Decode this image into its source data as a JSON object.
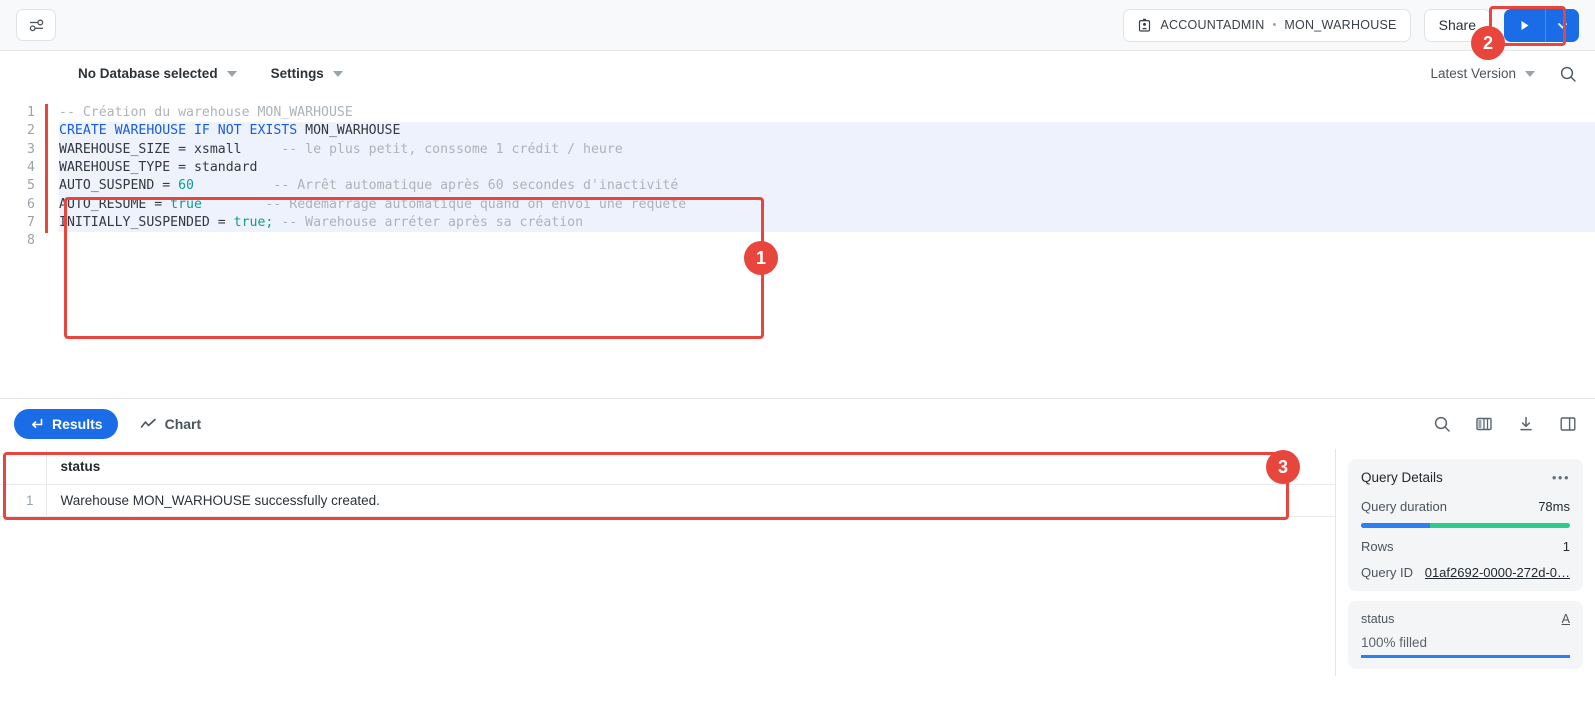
{
  "topbar": {
    "settings_icon": "sliders-icon",
    "role_icon": "badge-id-icon",
    "role": "ACCOUNTADMIN",
    "separator_dot": "•",
    "warehouse": "MON_WARHOUSE",
    "share_label": "Share",
    "run_icon": "play-icon",
    "run_caret_icon": "chevron-down-icon",
    "run_color": "#1a6ce7"
  },
  "editor_toolbar": {
    "database_label": "No Database selected",
    "settings_label": "Settings",
    "version_label": "Latest Version",
    "search_icon": "search-icon"
  },
  "editor": {
    "line_numbers": [
      "1",
      "2",
      "3",
      "4",
      "5",
      "6",
      "7",
      "8"
    ],
    "lines": [
      {
        "n": 1,
        "segments": [
          {
            "t": "-- Création du warehouse MON_WARHOUSE",
            "c": "cm"
          }
        ]
      },
      {
        "n": 2,
        "segments": [
          {
            "t": "CREATE WAREHOUSE IF NOT EXISTS ",
            "c": "k"
          },
          {
            "t": "MON_WARHOUSE",
            "c": "pl"
          }
        ]
      },
      {
        "n": 3,
        "segments": [
          {
            "t": "WAREHOUSE_SIZE = xsmall     ",
            "c": "pl"
          },
          {
            "t": "-- le plus petit, conssome 1 crédit / heure",
            "c": "cm"
          }
        ]
      },
      {
        "n": 4,
        "segments": [
          {
            "t": "WAREHOUSE_TYPE = standard",
            "c": "pl"
          }
        ]
      },
      {
        "n": 5,
        "segments": [
          {
            "t": "AUTO_SUSPEND = ",
            "c": "pl"
          },
          {
            "t": "60",
            "c": "num"
          },
          {
            "t": "          ",
            "c": "pl"
          },
          {
            "t": "-- Arrêt automatique après 60 secondes d'inactivité",
            "c": "cm"
          }
        ]
      },
      {
        "n": 6,
        "segments": [
          {
            "t": "AUTO_RESUME = ",
            "c": "pl"
          },
          {
            "t": "true",
            "c": "bool"
          },
          {
            "t": "        ",
            "c": "pl"
          },
          {
            "t": "-- Redémarrage automatique quand on envoi une requête",
            "c": "cm"
          }
        ]
      },
      {
        "n": 7,
        "segments": [
          {
            "t": "INITIALLY_SUSPENDED = ",
            "c": "pl"
          },
          {
            "t": "true;",
            "c": "bool"
          },
          {
            "t": " ",
            "c": "pl"
          },
          {
            "t": "-- Warehouse arréter après sa création",
            "c": "cm"
          }
        ]
      },
      {
        "n": 8,
        "segments": [
          {
            "t": "",
            "c": "pl"
          }
        ]
      }
    ]
  },
  "results": {
    "tab_results_label": "Results",
    "tab_results_icon": "return-arrow-icon",
    "tab_chart_label": "Chart",
    "tab_chart_icon": "line-chart-icon",
    "toolbar_icons": [
      "search-icon",
      "columns-icon",
      "download-icon",
      "panel-toggle-icon"
    ],
    "columns": [
      "status"
    ],
    "rows": [
      {
        "num": "1",
        "status": "Warehouse MON_WARHOUSE successfully created."
      }
    ]
  },
  "query_details": {
    "title": "Query Details",
    "more_icon": "ellipsis-icon",
    "duration_label": "Query duration",
    "duration_value": "78ms",
    "bar_blue_pct": 33,
    "bar_blue_color": "#2d7ff0",
    "bar_green_color": "#2ecb8d",
    "rows_label": "Rows",
    "rows_value": "1",
    "query_id_label": "Query ID",
    "query_id_value": "01af2692-0000-272d-0…",
    "column_stat": {
      "name": "status",
      "type_icon": "A",
      "fill_text": "100% filled",
      "fill_pct": 100,
      "bar_color": "#2d7ff0"
    }
  },
  "annotations": {
    "color": "#e8453c",
    "badges": [
      {
        "id": "1",
        "target": "sql-code-block"
      },
      {
        "id": "2",
        "target": "run-query-button"
      },
      {
        "id": "3",
        "target": "results-table"
      }
    ]
  }
}
